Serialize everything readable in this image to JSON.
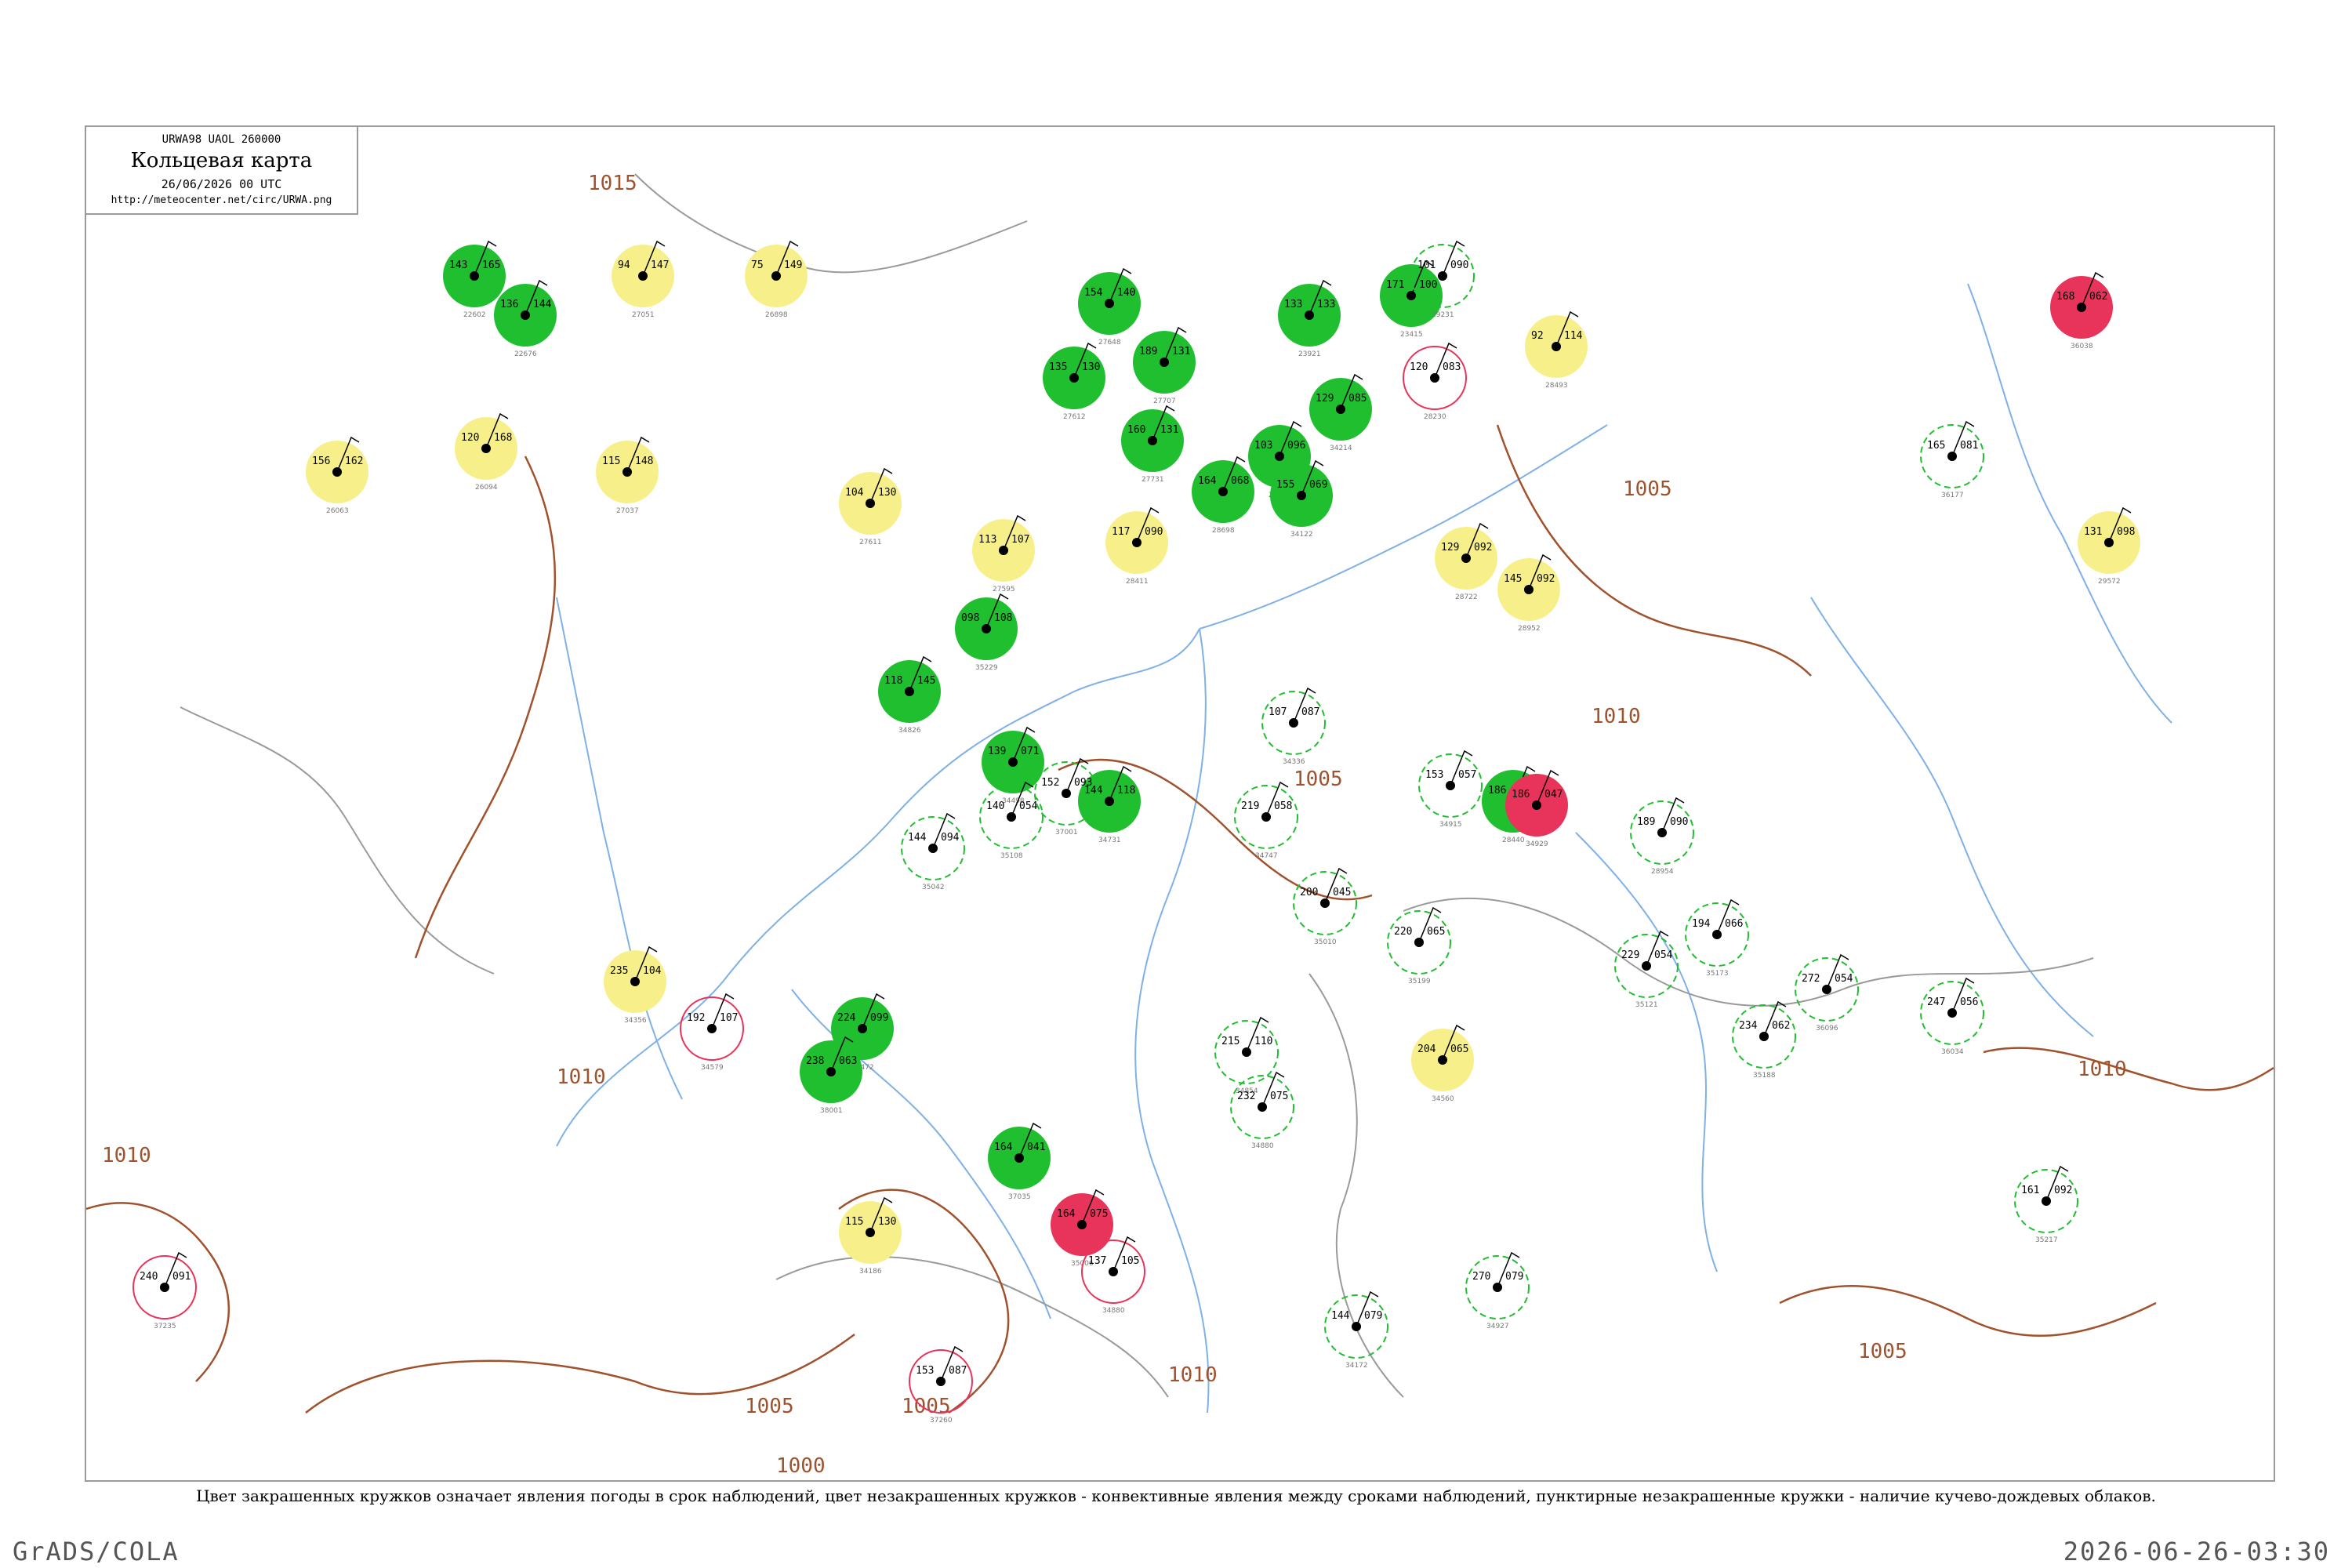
{
  "header": {
    "code_line": "URWA98  UAOL  260000",
    "title": "Кольцевая карта",
    "date": "26/06/2026 00 UTC",
    "url": "http://meteocenter.net/circ/URWA.png"
  },
  "caption": "Цвет закрашенных кружков означает явления погоды в срок наблюдений, цвет незакрашенных кружков - конвективные явления между сроками наблюдений, пунктирные незакрашенные кружки - наличие кучево-дождевых облаков.",
  "footer": {
    "left": "GrADS/COLA",
    "right": "2026-06-26-03:30"
  },
  "colors": {
    "green": "#1fbf2f",
    "yellow": "#f7f08a",
    "red": "#e8335a",
    "isobar": "#a0522d",
    "river": "#7fb0e6",
    "border": "#9a9a9a"
  },
  "isobar_labels": [
    "1015",
    "1010",
    "1005",
    "1005",
    "1010",
    "1005",
    "1010",
    "1005",
    "1010",
    "1005",
    "1000",
    "1010"
  ],
  "stations": [
    {
      "kind": "filled",
      "color": "green",
      "temp": "143",
      "pres": "165",
      "id": "22602"
    },
    {
      "kind": "filled",
      "color": "green",
      "temp": "136",
      "pres": "144",
      "id": "22676"
    },
    {
      "kind": "filled",
      "color": "green",
      "temp": "171",
      "pres": "100",
      "id": "23415"
    },
    {
      "kind": "filled",
      "color": "green",
      "temp": "133",
      "pres": "133",
      "id": "23921"
    },
    {
      "kind": "filled",
      "color": "green",
      "temp": "154",
      "pres": "140",
      "id": "27648"
    },
    {
      "kind": "filled",
      "color": "green",
      "temp": "189",
      "pres": "131",
      "id": "27707"
    },
    {
      "kind": "filled",
      "color": "green",
      "temp": "135",
      "pres": "130",
      "id": "27612"
    },
    {
      "kind": "filled",
      "color": "green",
      "temp": "160",
      "pres": "131",
      "id": "27731"
    },
    {
      "kind": "filled",
      "color": "green",
      "temp": "103",
      "pres": "096",
      "id": "28225"
    },
    {
      "kind": "filled",
      "color": "green",
      "temp": "129",
      "pres": "085",
      "id": "34214"
    },
    {
      "kind": "filled",
      "color": "green",
      "temp": "155",
      "pres": "069",
      "id": "34122"
    },
    {
      "kind": "filled",
      "color": "green",
      "temp": "164",
      "pres": "068",
      "id": "28698"
    },
    {
      "kind": "filled",
      "color": "green",
      "temp": "098",
      "pres": "108",
      "id": "35229"
    },
    {
      "kind": "filled",
      "color": "green",
      "temp": "118",
      "pres": "145",
      "id": "34826"
    },
    {
      "kind": "filled",
      "color": "green",
      "temp": "139",
      "pres": "071",
      "id": "34498"
    },
    {
      "kind": "filled",
      "color": "green",
      "temp": "144",
      "pres": "118",
      "id": "34731"
    },
    {
      "kind": "filled",
      "color": "green",
      "temp": "224",
      "pres": "099",
      "id": "37472"
    },
    {
      "kind": "filled",
      "color": "green",
      "temp": "238",
      "pres": "063",
      "id": "38001"
    },
    {
      "kind": "filled",
      "color": "green",
      "temp": "164",
      "pres": "041",
      "id": "37035"
    },
    {
      "kind": "filled",
      "color": "green",
      "temp": "186",
      "pres": "066",
      "id": "28440"
    },
    {
      "kind": "filled",
      "color": "yellow",
      "temp": "156",
      "pres": "162",
      "id": "26063"
    },
    {
      "kind": "filled",
      "color": "yellow",
      "temp": "120",
      "pres": "168",
      "id": "26094"
    },
    {
      "kind": "filled",
      "color": "yellow",
      "temp": "115",
      "pres": "148",
      "id": "27037"
    },
    {
      "kind": "filled",
      "color": "yellow",
      "temp": "94",
      "pres": "147",
      "id": "27051"
    },
    {
      "kind": "filled",
      "color": "yellow",
      "temp": "75",
      "pres": "149",
      "id": "26898"
    },
    {
      "kind": "filled",
      "color": "yellow",
      "temp": "104",
      "pres": "130",
      "id": "27611"
    },
    {
      "kind": "filled",
      "color": "yellow",
      "temp": "113",
      "pres": "107",
      "id": "27595"
    },
    {
      "kind": "filled",
      "color": "yellow",
      "temp": "117",
      "pres": "090",
      "id": "28411"
    },
    {
      "kind": "filled",
      "color": "yellow",
      "temp": "92",
      "pres": "114",
      "id": "28493"
    },
    {
      "kind": "filled",
      "color": "yellow",
      "temp": "129",
      "pres": "092",
      "id": "28722"
    },
    {
      "kind": "filled",
      "color": "yellow",
      "temp": "235",
      "pres": "104",
      "id": "34356"
    },
    {
      "kind": "filled",
      "color": "yellow",
      "temp": "204",
      "pres": "065",
      "id": "34560"
    },
    {
      "kind": "filled",
      "color": "yellow",
      "temp": "115",
      "pres": "130",
      "id": "34186"
    },
    {
      "kind": "filled",
      "color": "yellow",
      "temp": "131",
      "pres": "098",
      "id": "29572"
    },
    {
      "kind": "filled",
      "color": "yellow",
      "temp": "145",
      "pres": "092",
      "id": "28952"
    },
    {
      "kind": "filled",
      "color": "red",
      "temp": "164",
      "pres": "075",
      "id": "35006"
    },
    {
      "kind": "filled",
      "color": "red",
      "temp": "168",
      "pres": "062",
      "id": "36038"
    },
    {
      "kind": "filled",
      "color": "red",
      "temp": "186",
      "pres": "047",
      "id": "34929"
    },
    {
      "kind": "ring",
      "color": "red",
      "temp": "240",
      "pres": "091",
      "id": "37235"
    },
    {
      "kind": "ring",
      "color": "red",
      "temp": "192",
      "pres": "107",
      "id": "34579"
    },
    {
      "kind": "ring",
      "color": "red",
      "temp": "120",
      "pres": "083",
      "id": "28230"
    },
    {
      "kind": "ring",
      "color": "red",
      "temp": "153",
      "pres": "087",
      "id": "37260"
    },
    {
      "kind": "ring",
      "color": "red",
      "temp": "137",
      "pres": "105",
      "id": "34880"
    },
    {
      "kind": "dashed",
      "color": "green",
      "temp": "101",
      "pres": "090",
      "id": "29231"
    },
    {
      "kind": "dashed",
      "color": "green",
      "temp": "107",
      "pres": "087",
      "id": "34336"
    },
    {
      "kind": "dashed",
      "color": "green",
      "temp": "219",
      "pres": "058",
      "id": "34747"
    },
    {
      "kind": "dashed",
      "color": "green",
      "temp": "200",
      "pres": "045",
      "id": "35010"
    },
    {
      "kind": "dashed",
      "color": "green",
      "temp": "220",
      "pres": "065",
      "id": "35199"
    },
    {
      "kind": "dashed",
      "color": "green",
      "temp": "215",
      "pres": "110",
      "id": "34854"
    },
    {
      "kind": "dashed",
      "color": "green",
      "temp": "232",
      "pres": "075",
      "id": "34880"
    },
    {
      "kind": "dashed",
      "color": "green",
      "temp": "270",
      "pres": "079",
      "id": "34927"
    },
    {
      "kind": "dashed",
      "color": "green",
      "temp": "229",
      "pres": "054",
      "id": "35121"
    },
    {
      "kind": "dashed",
      "color": "green",
      "temp": "272",
      "pres": "054",
      "id": "36096"
    },
    {
      "kind": "dashed",
      "color": "green",
      "temp": "247",
      "pres": "056",
      "id": "36034"
    },
    {
      "kind": "dashed",
      "color": "green",
      "temp": "234",
      "pres": "062",
      "id": "35188"
    },
    {
      "kind": "dashed",
      "color": "green",
      "temp": "194",
      "pres": "066",
      "id": "35173"
    },
    {
      "kind": "dashed",
      "color": "green",
      "temp": "189",
      "pres": "090",
      "id": "28954"
    },
    {
      "kind": "dashed",
      "color": "green",
      "temp": "153",
      "pres": "057",
      "id": "34915"
    },
    {
      "kind": "dashed",
      "color": "green",
      "temp": "140",
      "pres": "054",
      "id": "35108"
    },
    {
      "kind": "dashed",
      "color": "green",
      "temp": "165",
      "pres": "081",
      "id": "36177"
    },
    {
      "kind": "dashed",
      "color": "green",
      "temp": "161",
      "pres": "092",
      "id": "35217"
    },
    {
      "kind": "dashed",
      "color": "green",
      "temp": "144",
      "pres": "079",
      "id": "34172"
    },
    {
      "kind": "dashed",
      "color": "green",
      "temp": "152",
      "pres": "093",
      "id": "37001"
    },
    {
      "kind": "dashed",
      "color": "green",
      "temp": "144",
      "pres": "094",
      "id": "35042"
    }
  ]
}
